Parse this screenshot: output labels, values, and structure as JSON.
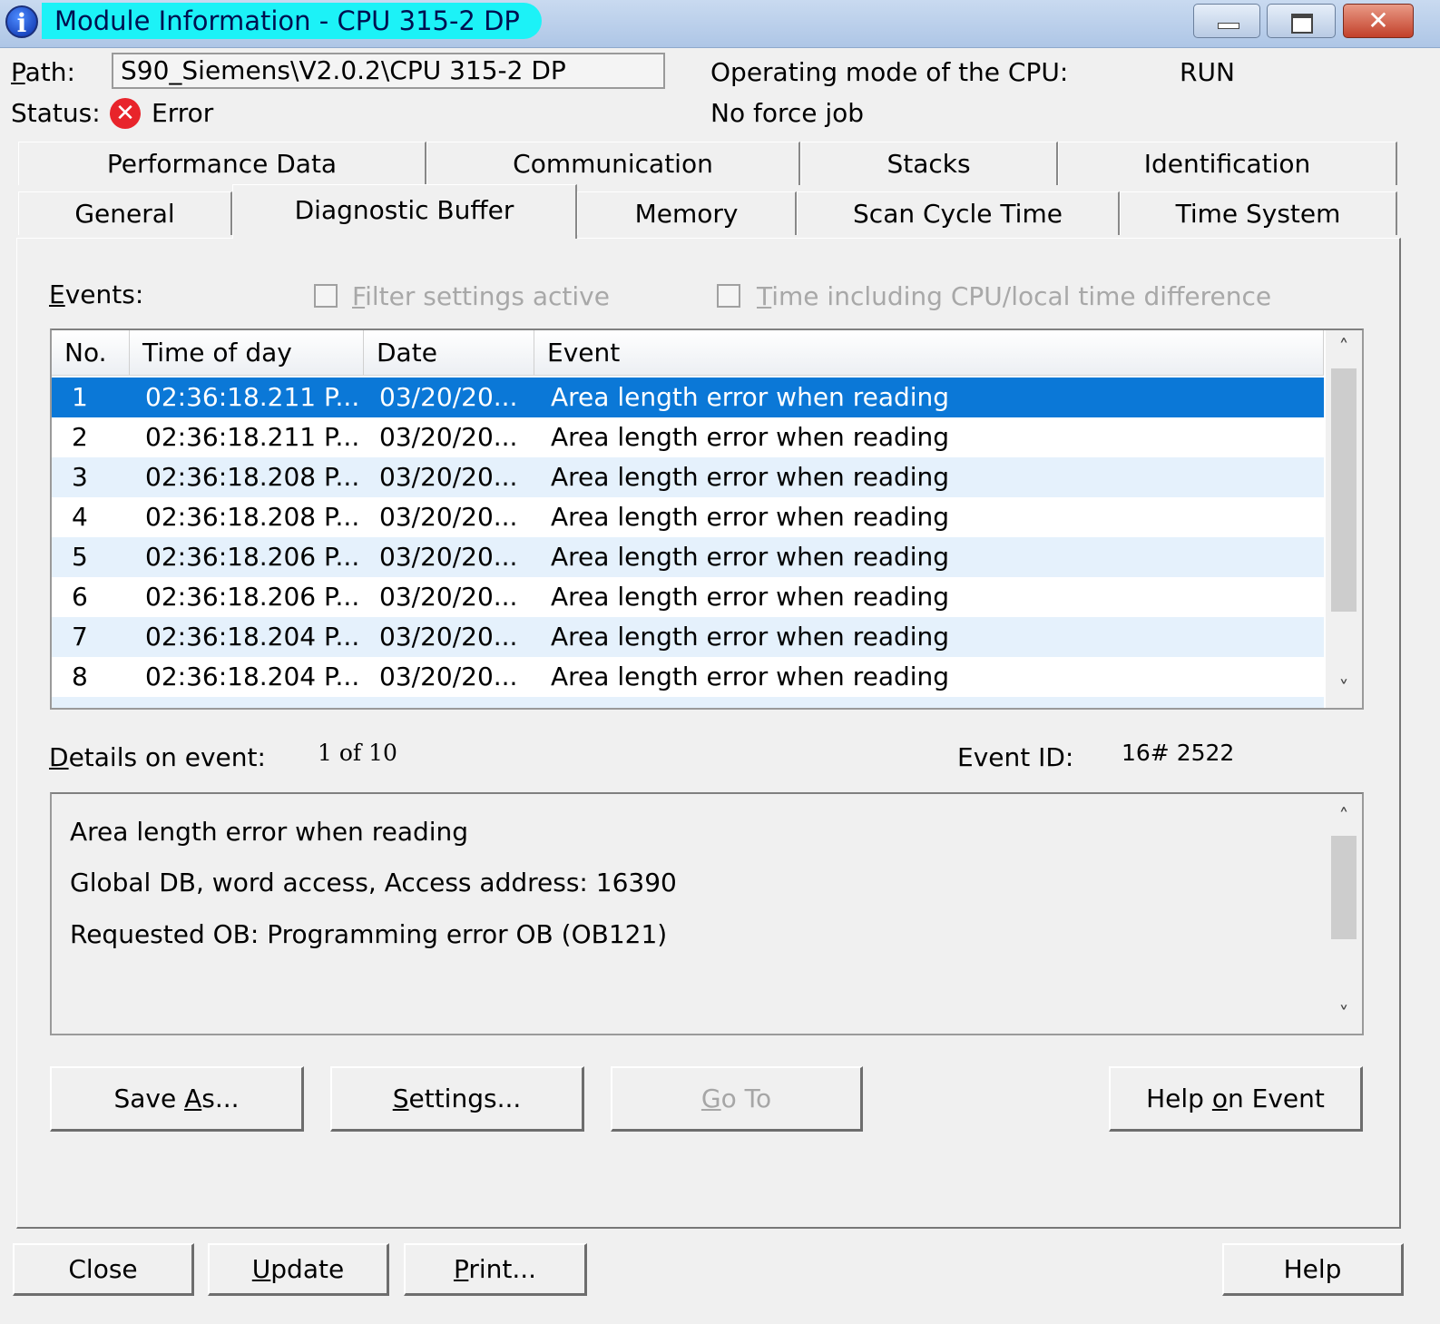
{
  "window": {
    "title": "Module Information - CPU 315-2 DP",
    "icon_glyph": "i",
    "close_glyph": "✕"
  },
  "header": {
    "path_label_prefix": "P",
    "path_label_rest": "ath:",
    "path_value": "S90_Siemens\\V2.0.2\\CPU 315-2 DP",
    "status_label": "Status:",
    "status_icon_glyph": "✕",
    "status_value": "Error",
    "opmode_label": "Operating mode of the  CPU:",
    "opmode_value": "RUN",
    "force_job": "No force job"
  },
  "tabs": {
    "row1": [
      "Performance Data",
      "Communication",
      "Stacks",
      "Identification"
    ],
    "row2": [
      "General",
      "Diagnostic Buffer",
      "Memory",
      "Scan Cycle Time",
      "Time System"
    ],
    "active": "Diagnostic Buffer"
  },
  "events": {
    "label_prefix": "E",
    "label_rest": "vents:",
    "filter_label_prefix": "F",
    "filter_label_rest": "ilter settings active",
    "time_label_prefix": "T",
    "time_label_rest": "ime including CPU/local time difference",
    "columns": [
      "No.",
      "Time of day",
      "Date",
      "Event"
    ],
    "rows": [
      {
        "no": "1",
        "time": "02:36:18.211 P...",
        "date": "03/20/20...",
        "event": "Area length error when reading"
      },
      {
        "no": "2",
        "time": "02:36:18.211 P...",
        "date": "03/20/20...",
        "event": "Area length error when reading"
      },
      {
        "no": "3",
        "time": "02:36:18.208 P...",
        "date": "03/20/20...",
        "event": "Area length error when reading"
      },
      {
        "no": "4",
        "time": "02:36:18.208 P...",
        "date": "03/20/20...",
        "event": "Area length error when reading"
      },
      {
        "no": "5",
        "time": "02:36:18.206 P...",
        "date": "03/20/20...",
        "event": "Area length error when reading"
      },
      {
        "no": "6",
        "time": "02:36:18.206 P...",
        "date": "03/20/20...",
        "event": "Area length error when reading"
      },
      {
        "no": "7",
        "time": "02:36:18.204 P...",
        "date": "03/20/20...",
        "event": "Area length error when reading"
      },
      {
        "no": "8",
        "time": "02:36:18.204 P...",
        "date": "03/20/20...",
        "event": "Area length error when reading"
      }
    ],
    "selected_row": 1
  },
  "details": {
    "label_prefix": "D",
    "label_rest": "etails on event:",
    "counter": "1  of  10",
    "event_id_label": "Event ID:",
    "event_id_value": "16#  2522",
    "lines": [
      "Area length error when reading",
      "Global DB, word access, Access address:  16390",
      "Requested OB: Programming error OB (OB121)"
    ]
  },
  "buttons": {
    "save_as_prefix": "Save ",
    "save_as_key": "A",
    "save_as_rest": "s...",
    "settings_key": "S",
    "settings_rest": "ettings...",
    "goto_key": "G",
    "goto_rest": "o To",
    "help_event_prefix": "Help ",
    "help_event_key": "o",
    "help_event_rest": "n Event",
    "close": "Close",
    "update_key": "U",
    "update_rest": "pdate",
    "print_key": "P",
    "print_rest": "rint...",
    "help": "Help"
  },
  "scroll": {
    "up_glyph": "˄",
    "down_glyph": "˅"
  }
}
